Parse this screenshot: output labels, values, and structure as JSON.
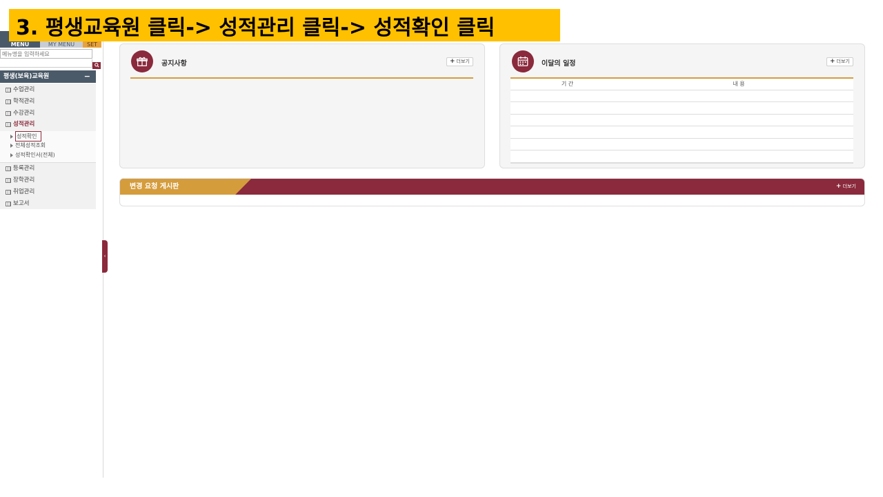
{
  "banner": {
    "text": "3. 평생교육원 클릭-> 성적관리 클릭-> 성적확인 클릭"
  },
  "sidebar": {
    "tabs": [
      "MENU",
      "MY MENU",
      "SET"
    ],
    "search": {
      "placeholder": "메뉴명을 입력하세요",
      "button_icon": "search-icon"
    },
    "section": {
      "title": "평생(보육)교육원",
      "toggle": "−"
    },
    "items": [
      {
        "label": "수업관리",
        "active": false
      },
      {
        "label": "학적관리",
        "active": false
      },
      {
        "label": "수강관리",
        "active": false
      },
      {
        "label": "성적관리",
        "active": true
      },
      {
        "label": "등록관리",
        "active": false
      },
      {
        "label": "장학관리",
        "active": false
      },
      {
        "label": "취업관리",
        "active": false
      },
      {
        "label": "보고서",
        "active": false
      }
    ],
    "subitems": [
      {
        "label": "성적확인",
        "highlighted": true
      },
      {
        "label": "전체성적조회",
        "highlighted": false
      },
      {
        "label": "성적확인서(전체)",
        "highlighted": false
      }
    ],
    "collapse_icon": "‹"
  },
  "notice": {
    "title": "공지사항",
    "more": "더보기",
    "icon": "gift-icon"
  },
  "schedule": {
    "title": "이달의 일정",
    "more": "더보기",
    "icon": "calendar-icon",
    "columns": [
      "기 간",
      "내 용"
    ],
    "rows": 6
  },
  "board": {
    "title": "변경 요청 게시판",
    "more": "더보기"
  },
  "colors": {
    "brand": "#8a2a3c",
    "accent": "#d59c3c",
    "banner": "#ffc000",
    "nav": "#4b5a68"
  }
}
